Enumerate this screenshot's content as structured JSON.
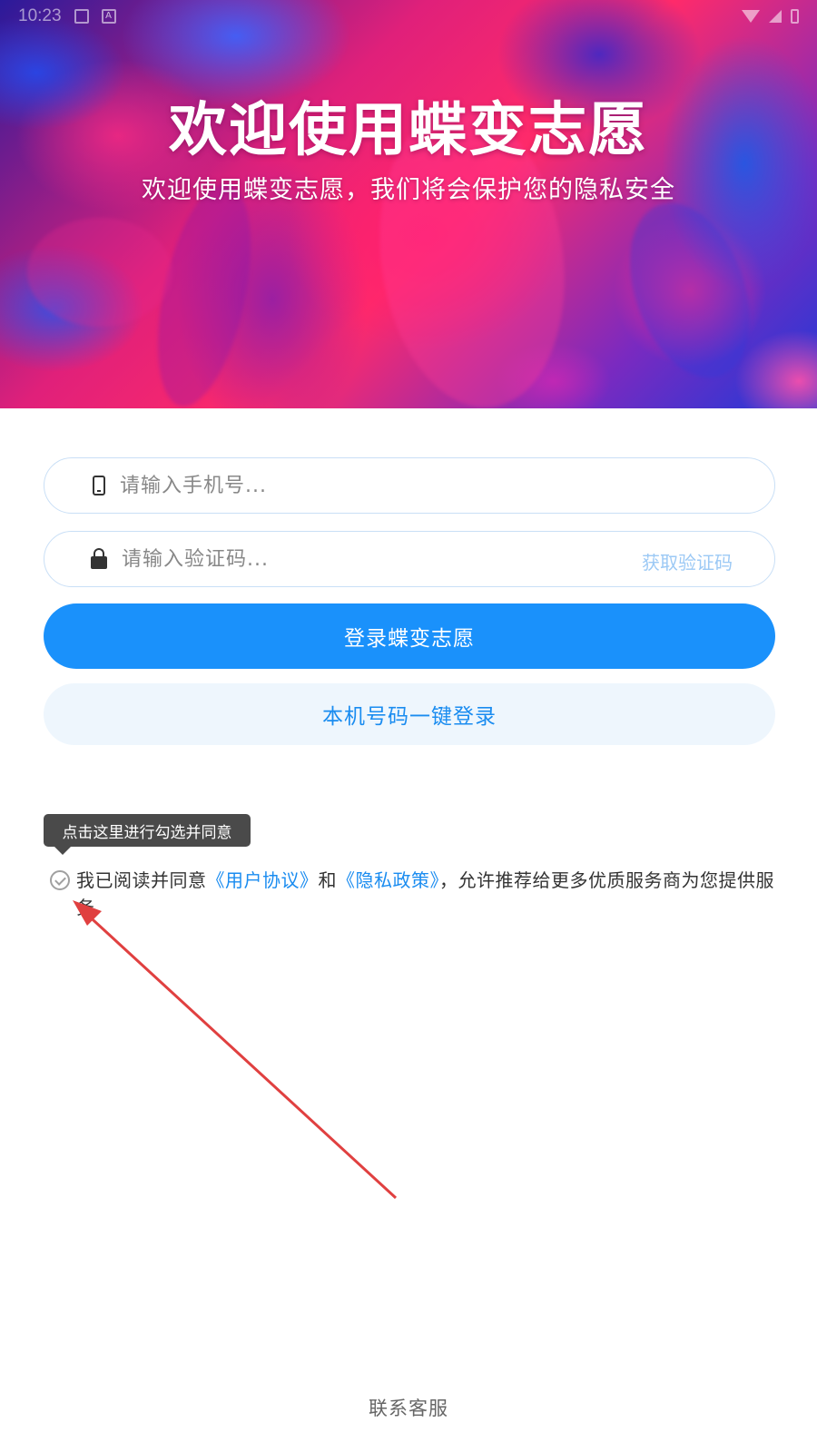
{
  "status_bar": {
    "time": "10:23",
    "notif_icon_1": "image-icon",
    "notif_icon_2_label": "A"
  },
  "hero": {
    "title": "欢迎使用蝶变志愿",
    "subtitle": "欢迎使用蝶变志愿，我们将会保护您的隐私安全"
  },
  "form": {
    "phone_placeholder": "请输入手机号...",
    "code_placeholder": "请输入验证码...",
    "get_code_label": "获取验证码"
  },
  "buttons": {
    "login_label": "登录蝶变志愿",
    "onekey_label": "本机号码一键登录"
  },
  "tooltip": {
    "text": "点击这里进行勾选并同意"
  },
  "agreement": {
    "prefix": "我已阅读并同意",
    "user_agreement": "《用户协议》",
    "and": "和",
    "privacy_policy": "《隐私政策》",
    "suffix": "，允许推荐给更多优质服务商为您提供服务"
  },
  "footer": {
    "contact_label": "联系客服"
  },
  "colors": {
    "primary": "#1a91fb",
    "link": "#1a8cf0",
    "get_code": "#9cc9f5",
    "secondary_bg": "#eef6fd",
    "annotation_arrow": "#e04040"
  }
}
